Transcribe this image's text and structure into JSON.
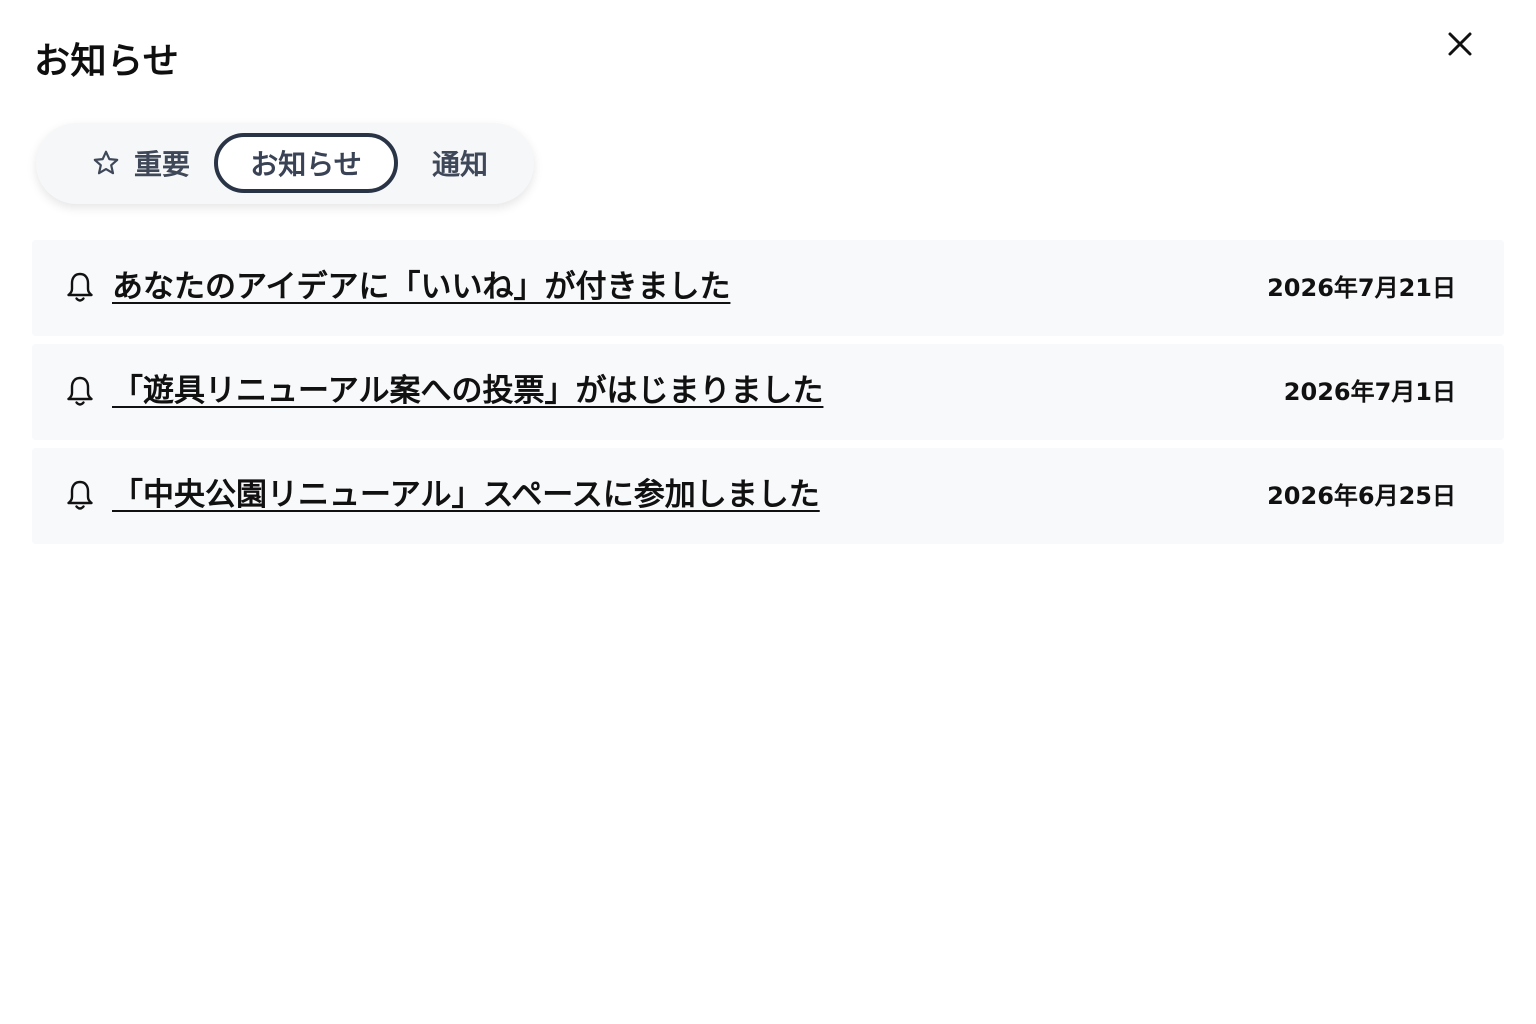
{
  "dialog": {
    "title": "お知らせ",
    "close_icon": "close-icon"
  },
  "tabs": [
    {
      "label": "重要",
      "icon": "star-icon",
      "selected": false
    },
    {
      "label": "お知らせ",
      "selected": true
    },
    {
      "label": "通知",
      "selected": false
    }
  ],
  "notices": [
    {
      "icon": "bell-icon",
      "title": "あなたのアイデアに「いいね」が付きました",
      "date": "2026年7月21日"
    },
    {
      "icon": "bell-icon",
      "title": "「遊具リニューアル案への投票」がはじまりました",
      "date": "2026年7月1日"
    },
    {
      "icon": "bell-icon",
      "title": "「中央公園リニューアル」スペースに参加しました",
      "date": "2026年6月25日"
    }
  ],
  "colors": {
    "selected_tab_border": "#2a3447",
    "tab_text": "#3f4858",
    "item_background": "#f8f9fb"
  }
}
